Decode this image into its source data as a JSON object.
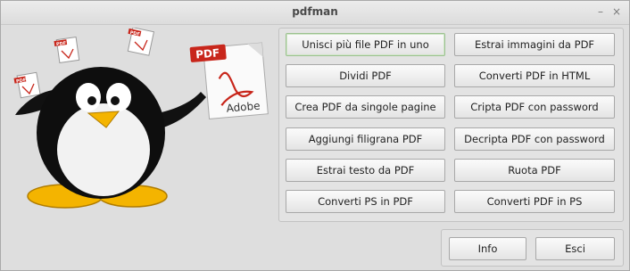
{
  "window": {
    "title": "pdfman",
    "minimize_symbol": "–",
    "close_symbol": "×"
  },
  "mascot": {
    "description_icon": "penguin-holding-pdf-icon",
    "pdf_label": "PDF",
    "adobe_label": "Adobe",
    "small_pdf_label": "PDF"
  },
  "buttons": {
    "merge": "Unisci più file PDF in uno",
    "extract_images": "Estrai immagini da PDF",
    "split": "Dividi PDF",
    "to_html": "Converti PDF in HTML",
    "from_pages": "Crea PDF da singole pagine",
    "encrypt": "Cripta PDF con password",
    "watermark": "Aggiungi filigrana PDF",
    "decrypt": "Decripta PDF con password",
    "extract_text": "Estrai testo da PDF",
    "rotate": "Ruota PDF",
    "ps_to_pdf": "Converti PS in PDF",
    "pdf_to_ps": "Converti PDF in PS",
    "info": "Info",
    "quit": "Esci"
  },
  "colors": {
    "accent_red": "#c8261b",
    "focus_border": "#9cc190"
  }
}
